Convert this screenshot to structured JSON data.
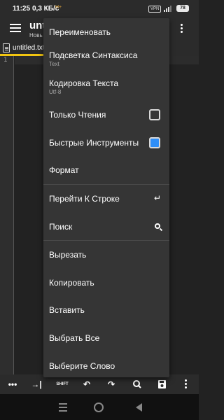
{
  "status_bar": {
    "time": "11:25",
    "speed": "0,3 КБ/с",
    "network": "H+",
    "vpn": "VPN",
    "battery": "78"
  },
  "app_bar": {
    "title": "unt",
    "subtitle": "Новь"
  },
  "tab": {
    "file_name": "untitled.txt"
  },
  "editor": {
    "line_number": "1"
  },
  "menu": {
    "items": [
      {
        "label": "Переименовать"
      },
      {
        "label": "Подсветка Синтаксиса",
        "sub": "Text"
      },
      {
        "label": "Кодировка Текста",
        "sub": "Utf-8"
      },
      {
        "label": "Только Чтения",
        "checked": false
      },
      {
        "label": "Быстрые Инструменты",
        "checked": true
      },
      {
        "label": "Формат"
      },
      {
        "label": "Перейти К Строке",
        "icon": "return-icon"
      },
      {
        "label": "Поиск",
        "icon": "search-icon"
      },
      {
        "label": "Вырезать"
      },
      {
        "label": "Копировать"
      },
      {
        "label": "Вставить"
      },
      {
        "label": "Выбрать Все"
      },
      {
        "label": "Выберите Слово"
      }
    ]
  },
  "toolbar": {
    "more": "•••",
    "tab": "→|",
    "shift": "SHIFT",
    "undo": "↶",
    "redo": "↷"
  },
  "colors": {
    "accent": "#f2c511",
    "checkbox_on": "#2f8ef7",
    "menu_bg": "#353535",
    "background": "#222222"
  }
}
